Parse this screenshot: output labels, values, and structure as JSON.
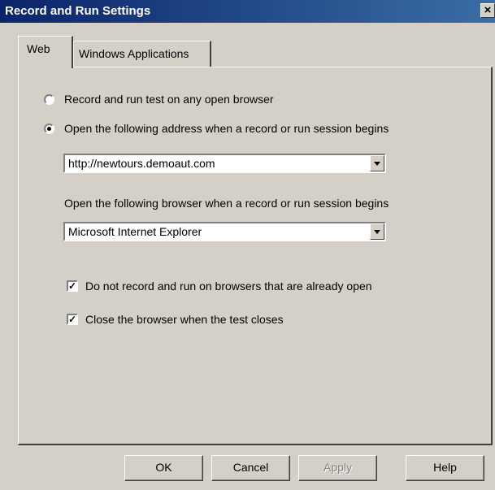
{
  "window": {
    "title": "Record and Run Settings",
    "close_glyph": "×"
  },
  "tabs": [
    {
      "label": "Web",
      "selected": true
    },
    {
      "label": "Windows Applications",
      "selected": false
    }
  ],
  "web": {
    "radio_any_browser": {
      "label": "Record and run test on any open browser",
      "selected": false
    },
    "radio_open_address": {
      "label": "Open the following address when a record or run session begins",
      "selected": true
    },
    "address_value": "http://newtours.demoaut.com",
    "browser_label": "Open the following browser when a record or run session begins",
    "browser_value": "Microsoft Internet Explorer",
    "check_not_record": {
      "label": "Do not record and run on browsers that are already open",
      "checked": true
    },
    "check_close_browser": {
      "label": "Close the browser when the test closes",
      "checked": true
    }
  },
  "buttons": {
    "ok": "OK",
    "cancel": "Cancel",
    "apply": "Apply",
    "help": "Help"
  }
}
